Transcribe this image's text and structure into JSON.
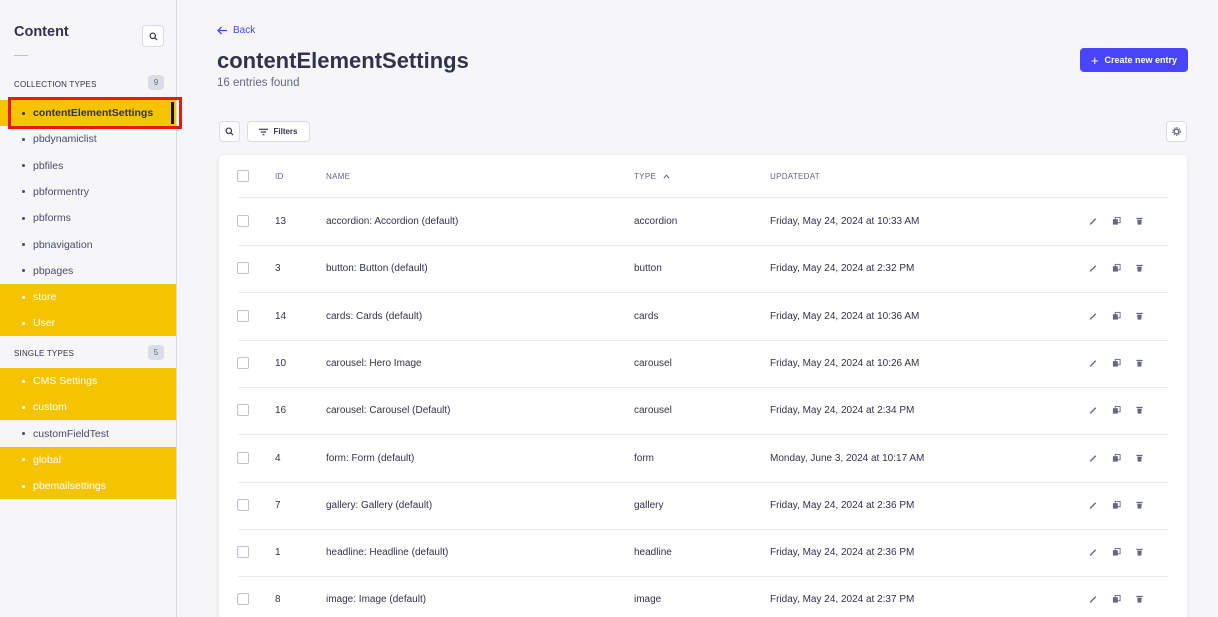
{
  "sidebar": {
    "title": "Content",
    "collection_types": {
      "label": "COLLECTION TYPES",
      "count": "9"
    },
    "single_types": {
      "label": "SINGLE TYPES",
      "count": "5"
    },
    "collection_items": [
      {
        "label": "contentElementSettings"
      },
      {
        "label": "pbdynamiclist"
      },
      {
        "label": "pbfiles"
      },
      {
        "label": "pbformentry"
      },
      {
        "label": "pbforms"
      },
      {
        "label": "pbnavigation"
      },
      {
        "label": "pbpages"
      },
      {
        "label": "store"
      },
      {
        "label": "User"
      }
    ],
    "single_items": [
      {
        "label": "CMS Settings"
      },
      {
        "label": "custom"
      },
      {
        "label": "customFieldTest"
      },
      {
        "label": "global"
      },
      {
        "label": "pbemailsettings"
      }
    ]
  },
  "header": {
    "back_label": "Back",
    "title": "contentElementSettings",
    "subtitle": "16 entries found",
    "create_label": "Create new entry"
  },
  "toolbar": {
    "filters_label": "Filters"
  },
  "table": {
    "columns": {
      "id": "ID",
      "name": "NAME",
      "type": "TYPE",
      "updated": "UPDATEDAT"
    },
    "rows": [
      {
        "id": "13",
        "name": "accordion: Accordion (default)",
        "type": "accordion",
        "updated": "Friday, May 24, 2024 at 10:33 AM"
      },
      {
        "id": "3",
        "name": "button: Button (default)",
        "type": "button",
        "updated": "Friday, May 24, 2024 at 2:32 PM"
      },
      {
        "id": "14",
        "name": "cards: Cards (default)",
        "type": "cards",
        "updated": "Friday, May 24, 2024 at 10:36 AM"
      },
      {
        "id": "10",
        "name": "carousel: Hero Image",
        "type": "carousel",
        "updated": "Friday, May 24, 2024 at 10:26 AM"
      },
      {
        "id": "16",
        "name": "carousel: Carousel (Default)",
        "type": "carousel",
        "updated": "Friday, May 24, 2024 at 2:34 PM"
      },
      {
        "id": "4",
        "name": "form: Form (default)",
        "type": "form",
        "updated": "Monday, June 3, 2024 at 10:17 AM"
      },
      {
        "id": "7",
        "name": "gallery: Gallery (default)",
        "type": "gallery",
        "updated": "Friday, May 24, 2024 at 2:36 PM"
      },
      {
        "id": "1",
        "name": "headline: Headline (default)",
        "type": "headline",
        "updated": "Friday, May 24, 2024 at 2:36 PM"
      },
      {
        "id": "8",
        "name": "image: Image (default)",
        "type": "image",
        "updated": "Friday, May 24, 2024 at 2:37 PM"
      }
    ]
  },
  "colors": {
    "accent": "#4945ff",
    "highlight": "#f5c400",
    "marker": "#e8180c"
  }
}
